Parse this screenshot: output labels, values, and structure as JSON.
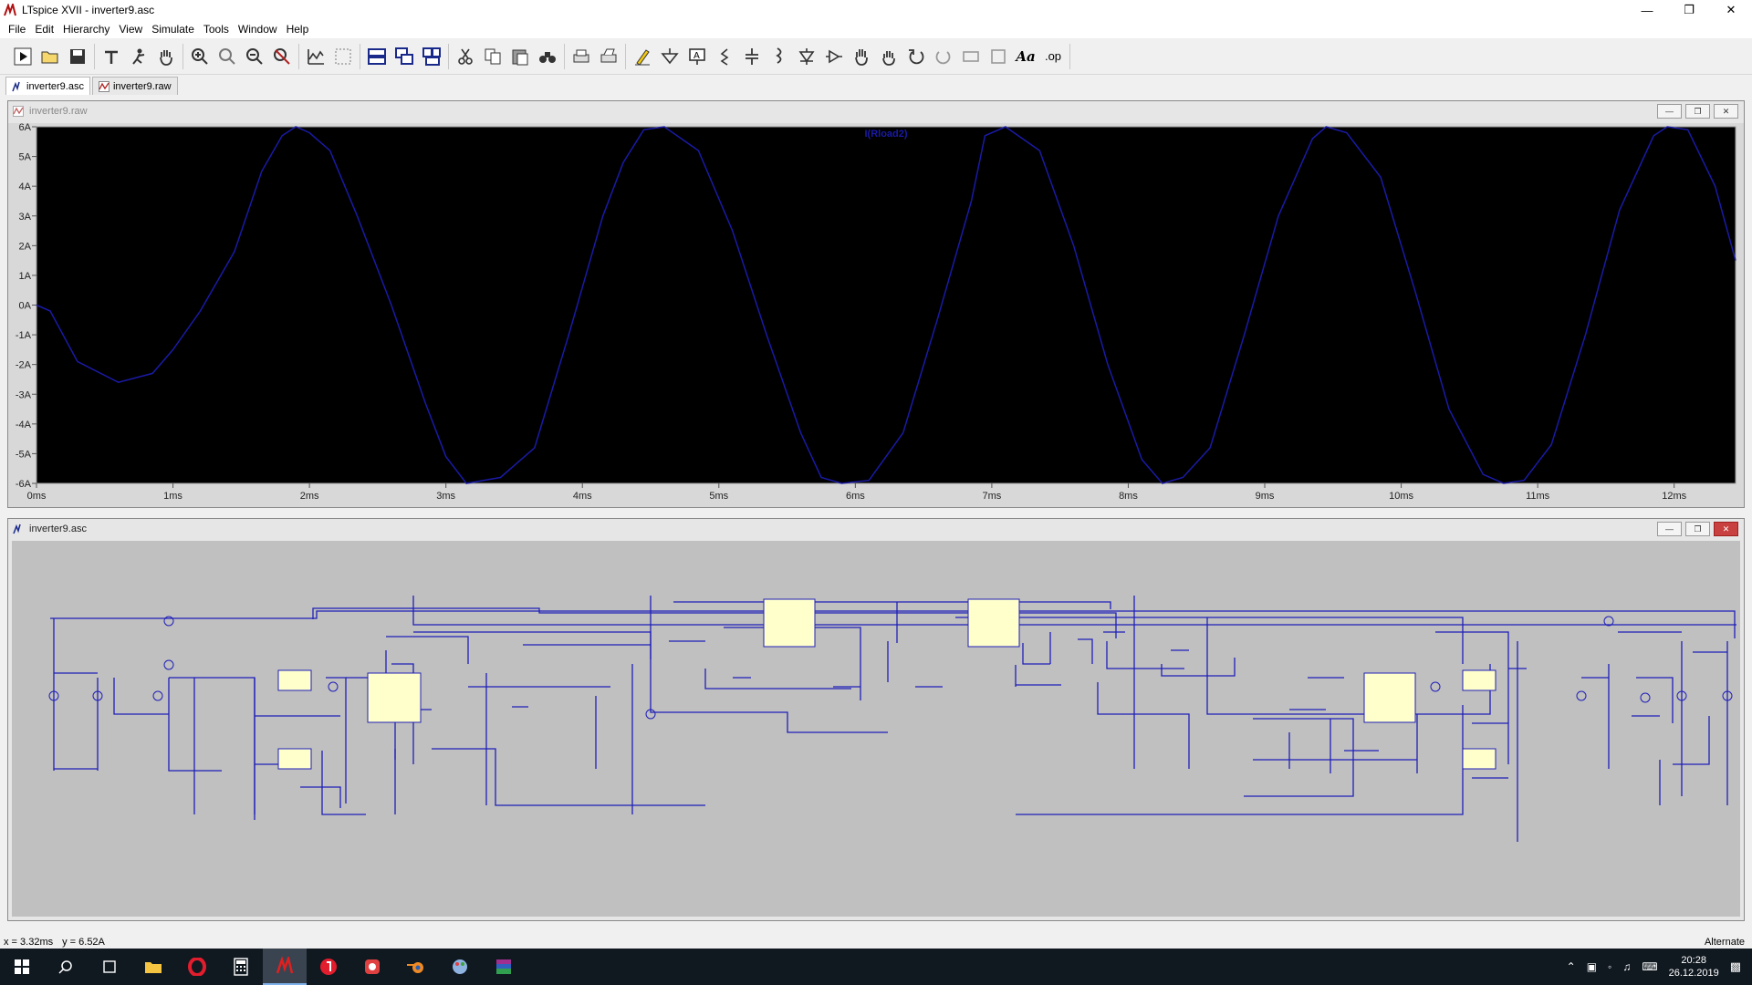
{
  "window": {
    "title": "LTspice XVII - inverter9.asc"
  },
  "menu": [
    "File",
    "Edit",
    "Hierarchy",
    "View",
    "Simulate",
    "Tools",
    "Window",
    "Help"
  ],
  "toolbar": {
    "op_label": ".op",
    "text_label": "Aa",
    "icons": [
      "run-icon",
      "open-icon",
      "save-icon",
      "control-panel-icon",
      "halt-icon",
      "pan-icon",
      "zoom-in-icon",
      "zoom-out-icon",
      "zoom-back-icon",
      "zoom-fit-icon",
      "autorange-icon",
      "waveform-icon",
      "tile-horizontal-icon",
      "cascade-icon",
      "tile-icon",
      "cut-icon",
      "copy-icon",
      "paste-icon",
      "find-icon",
      "print-icon",
      "print-preview-icon",
      "draw-wire-icon",
      "ground-icon",
      "label-icon",
      "resistor-icon",
      "capacitor-icon",
      "inductor-icon",
      "diode-icon",
      "component-icon",
      "move-icon",
      "drag-icon",
      "undo-icon",
      "redo-icon",
      "rotate-icon",
      "mirror-icon"
    ]
  },
  "tabs": [
    {
      "label": "inverter9.asc",
      "active": true
    },
    {
      "label": "inverter9.raw",
      "active": false
    }
  ],
  "plot_window": {
    "title": "inverter9.raw"
  },
  "schematic_window": {
    "title": "inverter9.asc"
  },
  "status": {
    "x": "x = 3.32ms",
    "y": "y = 6.52A",
    "mode": "Alternate"
  },
  "taskbar": {
    "time": "20:28",
    "date": "26.12.2019"
  },
  "colors": {
    "trace": "#1a1aa6",
    "plot_bg": "#000000",
    "wire": "#1f1fb8",
    "sch_bg": "#c0c0c0",
    "ic_body": "#ffffcc"
  },
  "chart_data": {
    "type": "line",
    "series": [
      {
        "name": "I(Rload2)",
        "x": [
          0,
          0.1,
          0.3,
          0.6,
          0.85,
          1.0,
          1.2,
          1.45,
          1.65,
          1.8,
          1.9,
          2.0,
          2.15,
          2.35,
          2.6,
          2.85,
          3.0,
          3.15,
          3.4,
          3.65,
          3.9,
          4.15,
          4.3,
          4.45,
          4.6,
          4.85,
          5.1,
          5.35,
          5.6,
          5.75,
          5.9,
          6.1,
          6.35,
          6.6,
          6.85,
          6.95,
          7.1,
          7.35,
          7.6,
          7.85,
          8.1,
          8.25,
          8.4,
          8.6,
          8.85,
          9.1,
          9.35,
          9.45,
          9.6,
          9.85,
          10.1,
          10.35,
          10.6,
          10.75,
          10.9,
          11.1,
          11.35,
          11.6,
          11.85,
          11.95,
          12.1,
          12.3,
          12.45
        ],
        "y": [
          0,
          -0.2,
          -1.9,
          -2.6,
          -2.3,
          -1.5,
          -0.2,
          1.8,
          4.5,
          5.7,
          6.0,
          5.8,
          5.2,
          3.0,
          0,
          -3.3,
          -5.1,
          -6.0,
          -5.8,
          -4.8,
          -1.0,
          3.0,
          4.8,
          5.9,
          6.0,
          5.2,
          2.5,
          -1.0,
          -4.3,
          -5.8,
          -6.0,
          -5.9,
          -4.3,
          -0.5,
          3.5,
          5.7,
          6.0,
          5.2,
          2.0,
          -2.0,
          -5.2,
          -6.0,
          -5.8,
          -4.8,
          -1.0,
          3.0,
          5.6,
          6.0,
          5.8,
          4.3,
          0.5,
          -3.5,
          -5.7,
          -6.0,
          -5.9,
          -4.7,
          -1.0,
          3.2,
          5.7,
          6.0,
          5.9,
          4.0,
          1.5
        ]
      }
    ],
    "xlim": [
      0,
      12.45
    ],
    "ylim": [
      -6,
      6
    ],
    "xticks": [
      "0ms",
      "1ms",
      "2ms",
      "3ms",
      "4ms",
      "5ms",
      "6ms",
      "7ms",
      "8ms",
      "9ms",
      "10ms",
      "11ms",
      "12ms"
    ],
    "yticks": [
      "6A",
      "5A",
      "4A",
      "3A",
      "2A",
      "1A",
      "0A",
      "-1A",
      "-2A",
      "-3A",
      "-4A",
      "-5A",
      "-6A"
    ],
    "legend": "top-center",
    "grid": false
  }
}
